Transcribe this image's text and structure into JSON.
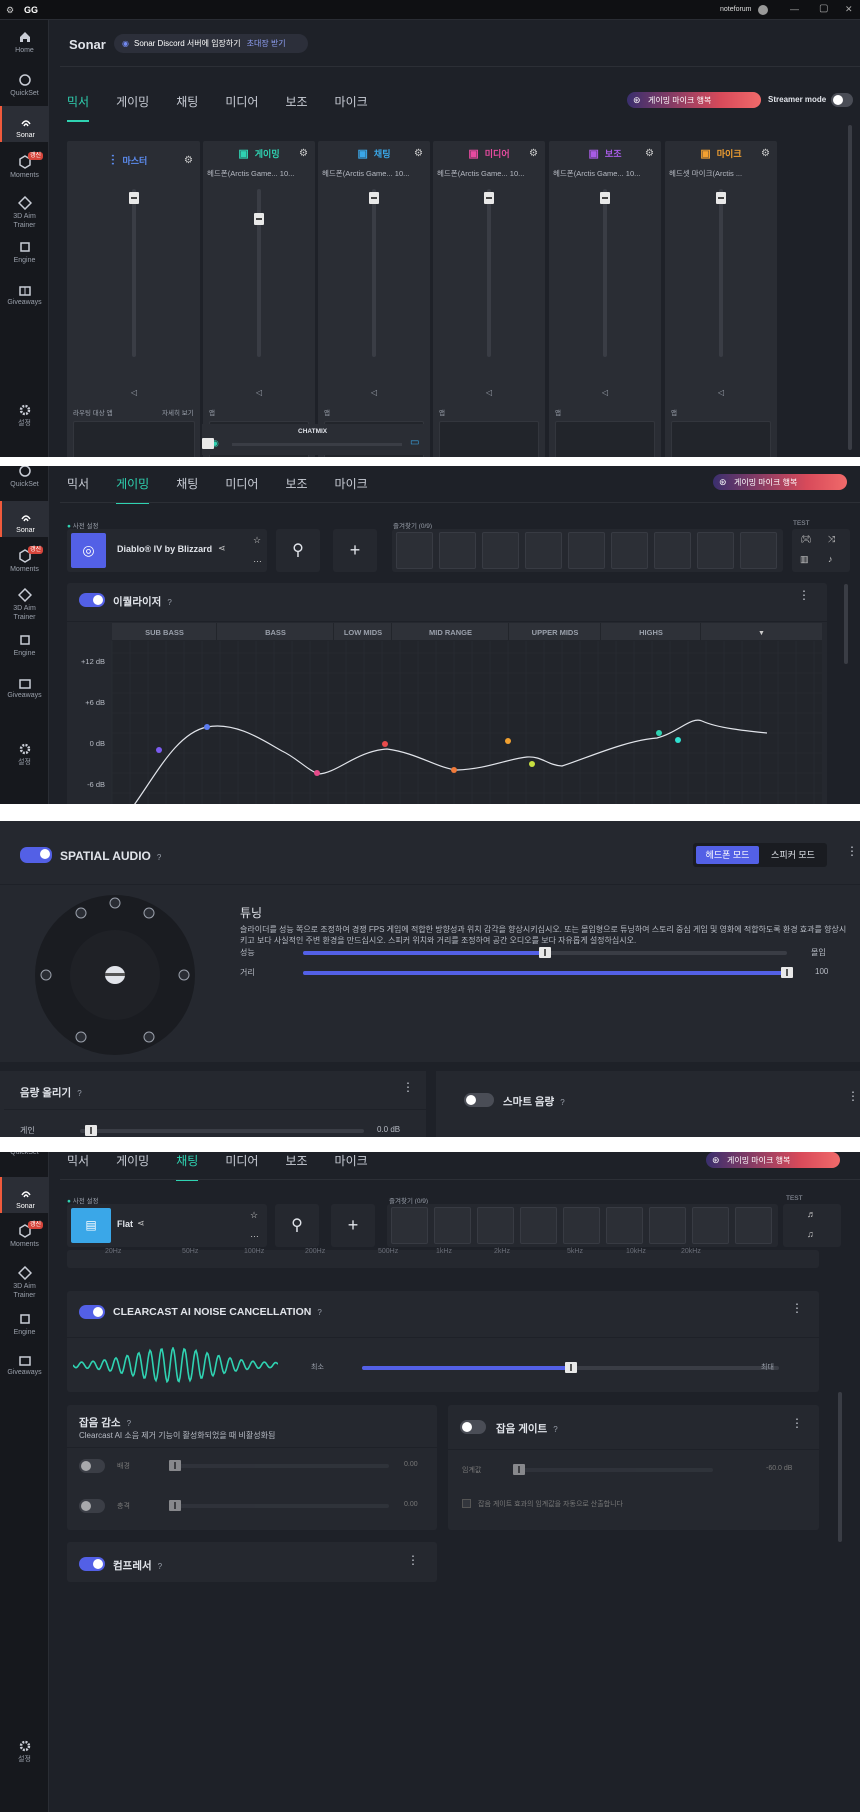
{
  "app": {
    "logo": "GG",
    "user": "noteforum",
    "win_min": "—",
    "win_max": "▢",
    "win_close": "✕"
  },
  "sidebar": {
    "home": "Home",
    "quickset": "QuickSet",
    "sonar": "Sonar",
    "moments": "Moments",
    "moments_badge": "갱신",
    "aim1": "3D Aim",
    "aim2": "Trainer",
    "engine": "Engine",
    "giveaways": "Giveaways",
    "settings": "설정"
  },
  "header": {
    "title": "Sonar",
    "discord_text": "Sonar Discord 서버에 입장하기",
    "discord_link": "초대장 받기"
  },
  "tabs": [
    "믹서",
    "게이밍",
    "채팅",
    "미디어",
    "보조",
    "마이크"
  ],
  "gaming_mic_btn": "게이밍 마이크 행복",
  "streamer_mode": "Streamer mode",
  "mixer": {
    "master": "마스터",
    "master_routed": "라우팅 대상 앱",
    "master_detail": "자세히 보기",
    "channels": [
      {
        "name": "게이밍",
        "device": "헤드폰(Arctis Game... 10...",
        "app": "앱",
        "color": "#2fd3b2",
        "level": 0.86
      },
      {
        "name": "채팅",
        "device": "헤드폰(Arctis Game... 10...",
        "app": "앱",
        "color": "#3aa7e8",
        "level": 1.0
      },
      {
        "name": "미디어",
        "device": "헤드폰(Arctis Game... 10...",
        "app": "앱",
        "color": "#e64ba0",
        "level": 1.0
      },
      {
        "name": "보조",
        "device": "헤드폰(Arctis Game... 10...",
        "app": "앱",
        "color": "#a85ce6",
        "level": 1.0
      },
      {
        "name": "마이크",
        "device": "헤드셋 마이크(Arctis ...",
        "app": "앱",
        "color": "#f2a031",
        "level": 1.0
      }
    ],
    "master_level": 1.0,
    "chatmix": "CHATMIX",
    "chatmix_value": 0.5
  },
  "gaming": {
    "preset_label": "사전 설정",
    "preset_name": "Diablo® IV by Blizzard",
    "favorites": "즐겨찾기 (0/9)",
    "test": "TEST",
    "eq_label": "이퀄라이저",
    "eq_q": "?",
    "bands": [
      "SUB BASS",
      "BASS",
      "LOW MIDS",
      "MID RANGE",
      "UPPER MIDS",
      "HIGHS"
    ],
    "db_labels": [
      "+12 dB",
      "+6 dB",
      "0 dB",
      "-6 dB"
    ],
    "eq_points": [
      {
        "c": "#7b5cf0"
      },
      {
        "c": "#5c7cf0"
      },
      {
        "c": "#e64b8a"
      },
      {
        "c": "#e84b4b"
      },
      {
        "c": "#f07a3a"
      },
      {
        "c": "#f0a030"
      },
      {
        "c": "#c8e040"
      },
      {
        "c": "#2fd3b2"
      },
      {
        "c": "#30e0d0"
      }
    ]
  },
  "spatial": {
    "title": "SPATIAL AUDIO",
    "q": "?",
    "mode_headphone": "헤드폰 모드",
    "mode_speaker": "스피커 모드",
    "tuning": "튜닝",
    "desc": "슬라이더를 성능 쪽으로 조정하여 경쟁 FPS 게임에 적합한 방향성과 위치 감각을 향상시키십시오. 또는 몰입형으로 튜닝하여 스토리 중심 게임 및 영화에 적합하도록 환경 효과를 향상시키고 보다 사실적인 주변 환경을 만드십시오. 스피커 위치와 거리를 조정하여 공간 오디오를 보다 자유롭게 설정하십시오.",
    "perf": "성능",
    "immersive": "몰입",
    "perf_value": 0.5,
    "distance": "거리",
    "distance_value": "100",
    "distance_level": 1.0,
    "volume_boost": "음량 올리기",
    "gain": "게인",
    "gain_value": "0.0 dB",
    "smart_volume": "스마트 음량"
  },
  "chat": {
    "preset_label": "사전 설정",
    "preset_name": "Flat",
    "favorites": "즐겨찾기 (0/9)",
    "test": "TEST",
    "freqs": [
      "20Hz",
      "50Hz",
      "100Hz",
      "200Hz",
      "500Hz",
      "1kHz",
      "2kHz",
      "5kHz",
      "10kHz",
      "20kHz"
    ],
    "clearcast": "CLEARCAST AI NOISE CANCELLATION",
    "q": "?",
    "min": "최소",
    "max": "최대",
    "clearcast_level": 0.5,
    "noise_reduce": "잡음 감소",
    "noise_note": "Clearcast AI 소음 제거 기능이 활성화되었을 때 비활성화됨",
    "bg": "배경",
    "bg_value": "0.00",
    "impact": "충격",
    "impact_value": "0.00",
    "noise_gate": "잡음 게이트",
    "threshold": "임계값",
    "threshold_value": "-60.0 dB",
    "gate_auto": "잡음 게이트 효과의 임계값을 자동으로 산출합니다",
    "compressor": "컴프레서"
  }
}
